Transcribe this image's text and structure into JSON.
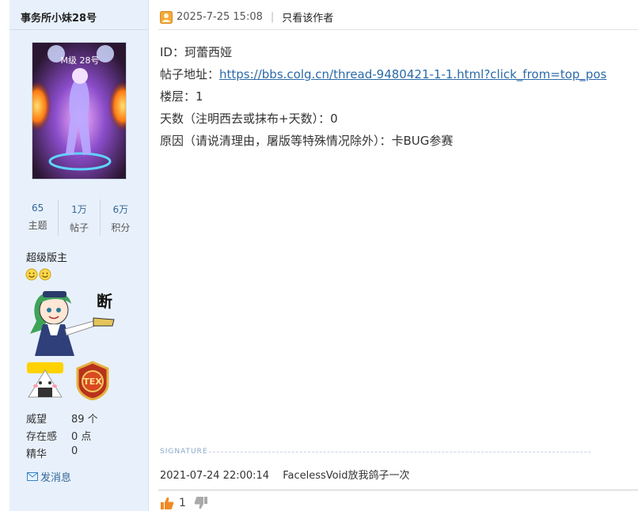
{
  "user": {
    "name": "事务所小妹28号",
    "avatar_text": "M级 28号",
    "stats": [
      {
        "value": "65",
        "label": "主题"
      },
      {
        "value": "1万",
        "label": "帖子"
      },
      {
        "value": "6万",
        "label": "积分"
      }
    ],
    "rank": "超级版主",
    "badge_text": "断",
    "medal_text": "TEX",
    "info": [
      {
        "key": "威望",
        "value": "89 个"
      },
      {
        "key": "存在感",
        "value": "0 点"
      },
      {
        "key": "精华",
        "value": "0"
      }
    ],
    "send_message": "发消息"
  },
  "post": {
    "date": "2025-7-25 15:08",
    "separator": "|",
    "only_author": "只看该作者",
    "lines": [
      "ID：珂蕾西娅",
      "帖子地址：",
      "楼层：1",
      "天数（注明西去或抹布+天数）：0",
      "原因（请说清理由，屠版等特殊情况除外）：卡BUG参赛"
    ],
    "link": "https://bbs.colg.cn/thread-9480421-1-1.html?click_from=top_pos"
  },
  "signature": {
    "label": "SIGNATURE",
    "time": "2021-07-24 22:00:14",
    "text": "FacelessVoid放我鸽子一次"
  },
  "votes": {
    "up_count": "1"
  },
  "colors": {
    "sidebar_bg": "#e8f1fb",
    "link": "#2b6aa8",
    "stat_value": "#336699"
  }
}
